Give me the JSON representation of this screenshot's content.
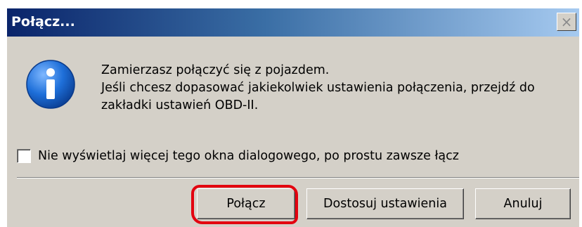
{
  "window": {
    "title": "Połącz...",
    "close_glyph": "×"
  },
  "icon": {
    "name": "info-icon",
    "glyph": "i",
    "color": "#1e6fd9"
  },
  "message": {
    "line1": "Zamierzasz połączyć się z pojazdem.",
    "line2": "Jeśli chcesz dopasować jakiekolwiek ustawienia połączenia, przejdź do",
    "line3": "zakładki ustawień OBD-II."
  },
  "checkbox": {
    "label": "Nie wyświetlaj więcej tego okna dialogowego, po prostu zawsze łącz",
    "checked": false
  },
  "buttons": {
    "connect": "Połącz",
    "settings": "Dostosuj ustawienia",
    "cancel": "Anuluj"
  },
  "colors": {
    "titlebar_start": "#0a246a",
    "titlebar_end": "#a6caf0",
    "dialog_bg": "#d4d0c8",
    "annotation": "#e3000f"
  }
}
